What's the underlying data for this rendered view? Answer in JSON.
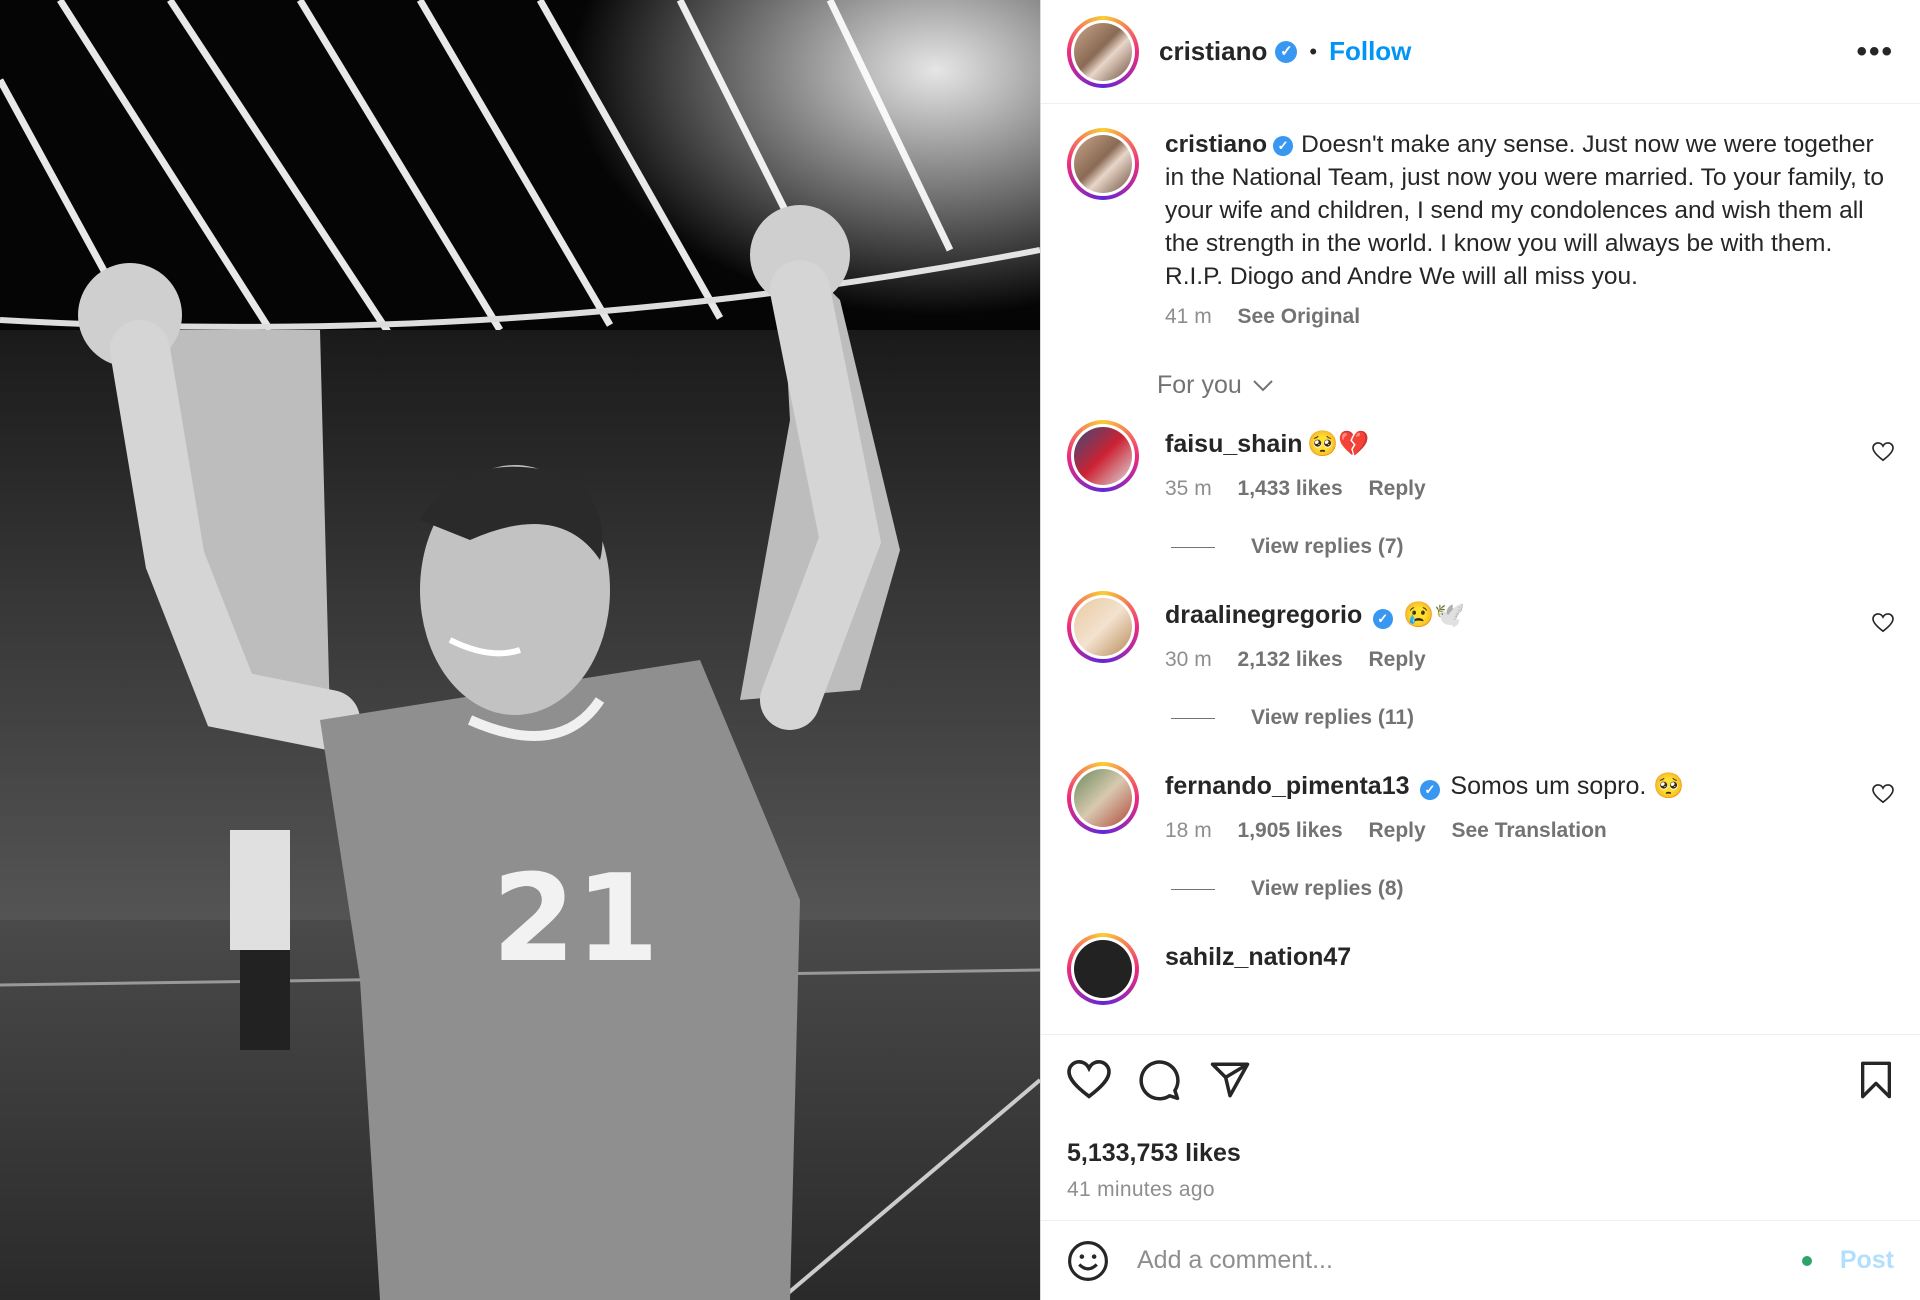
{
  "post": {
    "author": "cristiano",
    "follow_label": "Follow",
    "separator": "•",
    "more_label": "•••",
    "caption": "Doesn't make any sense. Just now we were together in the National Team, just now you were married. To your family, to your wife and children, I send my condolences and wish them all the strength in the world. I know you will always be with them. R.I.P. Diogo and Andre We will all miss you.",
    "caption_time": "41 m",
    "see_original": "See Original",
    "sort_label": "For you",
    "likes": "5,133,753 likes",
    "posted_ago": "41 minutes ago",
    "photo_jersey_number": "21"
  },
  "comments": [
    {
      "user": "faisu_shain",
      "text": "🥺💔",
      "time": "35 m",
      "likes": "1,433 likes",
      "reply": "Reply",
      "view_replies": "View replies (7)",
      "verified": false
    },
    {
      "user": "draalinegregorio",
      "text": "😢🕊️",
      "time": "30 m",
      "likes": "2,132 likes",
      "reply": "Reply",
      "view_replies": "View replies (11)",
      "verified": true
    },
    {
      "user": "fernando_pimenta13",
      "text": "Somos um sopro. 🥺",
      "time": "18 m",
      "likes": "1,905 likes",
      "reply": "Reply",
      "see_translation": "See Translation",
      "view_replies": "View replies (8)",
      "verified": true
    },
    {
      "user": "sahilz_nation47"
    }
  ],
  "composer": {
    "placeholder": "Add a comment...",
    "post_label": "Post"
  },
  "icons": {
    "verified": "verified-badge-icon",
    "like": "heart-icon",
    "comment": "comment-icon",
    "share": "share-icon",
    "save": "bookmark-icon",
    "emoji": "emoji-icon",
    "chevron": "chevron-down-icon"
  },
  "colors": {
    "accent": "#0095f6",
    "verified": "#3897f0",
    "muted": "#8e8e8e"
  }
}
